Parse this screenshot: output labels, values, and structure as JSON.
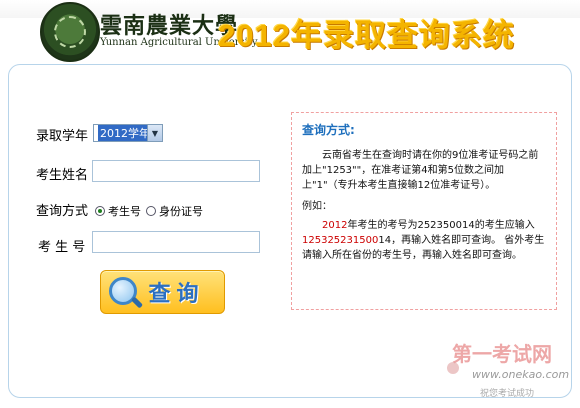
{
  "header": {
    "school_name_cn": "雲南農業大學",
    "school_name_en": "Yunnan Agricultural University",
    "system_title": "2012年录取查询系统"
  },
  "form": {
    "year_label": "录取学年",
    "year_value": "2012学年",
    "name_label": "考生姓名",
    "name_value": "",
    "method_label": "查询方式",
    "method_options": [
      "考生号",
      "身份证号"
    ],
    "method_selected": "考生号",
    "exam_no_label": "考 生 号",
    "exam_no_value": "",
    "query_button_label": "查询"
  },
  "info": {
    "title": "查询方式:",
    "text1": "云南省考生在查询时请在你的9位准考证号码之前加上\"1253\"\"，在准考证第4和第5位数之间加上\"1\"（专升本考生直接输12位准考证号）。",
    "example_label": "例如：",
    "example_year": "2012",
    "example_part1": "年考生的考号为252350014的考生应输入",
    "example_code": "125325231500",
    "example_part2": "14，再输入姓名即可查询。 省外考生请输入所在省份的考生号，再输入姓名即可查询。"
  },
  "watermark": {
    "cn": "第一考试网",
    "url": "www.onekao.com",
    "slogan": "祝您考试成功"
  },
  "colors": {
    "title_gold": "#f4b400",
    "panel_border": "#b7d4ea",
    "info_title_blue": "#1e6fbd",
    "accent_red": "#cc0000"
  }
}
